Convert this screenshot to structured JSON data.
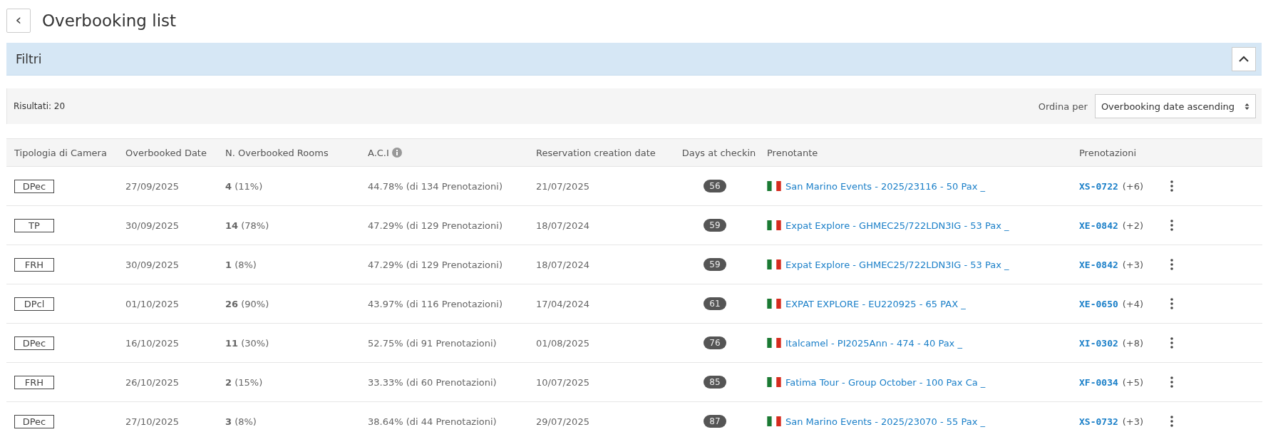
{
  "header": {
    "back_icon": "‹",
    "title": "Overbooking list"
  },
  "filters": {
    "title": "Filtri",
    "expanded": true
  },
  "results": {
    "label": "Risultati:",
    "count": "20",
    "sort_label": "Ordina per",
    "sort_value": "Overbooking date ascending"
  },
  "table": {
    "columns": [
      "Tipologia di Camera",
      "Overbooked Date",
      "N. Overbooked Rooms",
      "A.C.I",
      "Reservation creation date",
      "Days at checkin",
      "Prenotante",
      "Prenotazioni"
    ],
    "rows": [
      {
        "room_type": "DPec",
        "date": "27/09/2025",
        "rooms": "**4** (11%)",
        "aci": "44.78% (di 134 Prenotazioni)",
        "created": "21/07/2025",
        "days": "56",
        "booker": "San Marino Events - 2025/23116 - 50 Pax _",
        "code": "XS-0722",
        "extra": "(+6)"
      },
      {
        "room_type": "TP",
        "date": "30/09/2025",
        "rooms": "**14** (78%)",
        "aci": "47.29% (di 129 Prenotazioni)",
        "created": "18/07/2024",
        "days": "59",
        "booker": "Expat Explore - GHMEC25/722LDN3IG - 53 Pax _",
        "code": "XE-0842",
        "extra": "(+2)"
      },
      {
        "room_type": "FRH",
        "date": "30/09/2025",
        "rooms": "**1** (8%)",
        "aci": "47.29% (di 129 Prenotazioni)",
        "created": "18/07/2024",
        "days": "59",
        "booker": "Expat Explore - GHMEC25/722LDN3IG - 53 Pax _",
        "code": "XE-0842",
        "extra": "(+3)"
      },
      {
        "room_type": "DPcl",
        "date": "01/10/2025",
        "rooms": "**26** (90%)",
        "aci": "43.97% (di 116 Prenotazioni)",
        "created": "17/04/2024",
        "days": "61",
        "booker": "EXPAT EXPLORE - EU220925 - 65 PAX _",
        "code": "XE-0650",
        "extra": "(+4)"
      },
      {
        "room_type": "DPec",
        "date": "16/10/2025",
        "rooms": "**11** (30%)",
        "aci": "52.75% (di 91 Prenotazioni)",
        "created": "01/08/2025",
        "days": "76",
        "booker": "Italcamel - PI2025Ann - 474 - 40 Pax _",
        "code": "XI-0302",
        "extra": "(+8)"
      },
      {
        "room_type": "FRH",
        "date": "26/10/2025",
        "rooms": "**2** (15%)",
        "aci": "33.33% (di 60 Prenotazioni)",
        "created": "10/07/2025",
        "days": "85",
        "booker": "Fatima Tour - Group October - 100 Pax Ca _",
        "code": "XF-0034",
        "extra": "(+5)"
      },
      {
        "room_type": "DPec",
        "date": "27/10/2025",
        "rooms": "**3** (8%)",
        "aci": "38.64% (di 44 Prenotazioni)",
        "created": "29/07/2025",
        "days": "87",
        "booker": "San Marino Events - 2025/23070 - 55 Pax _",
        "code": "XS-0732",
        "extra": "(+3)"
      }
    ]
  }
}
